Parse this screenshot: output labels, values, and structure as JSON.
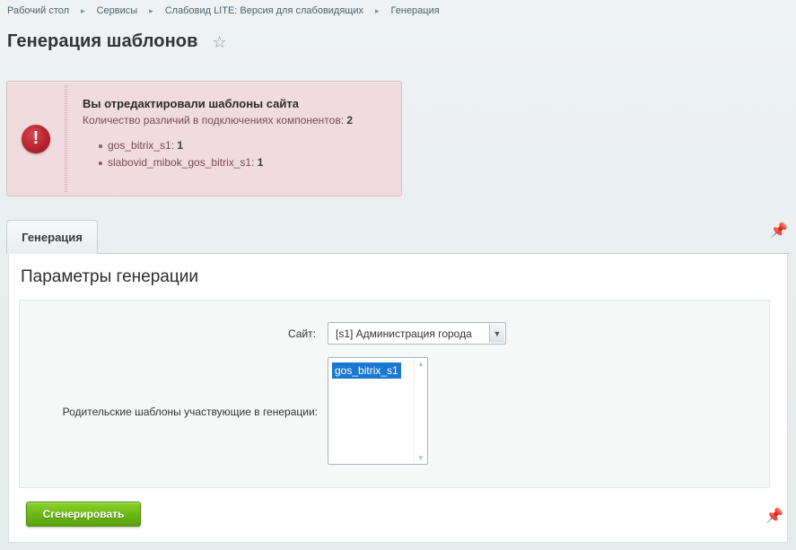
{
  "breadcrumb": {
    "items": [
      "Рабочий стол",
      "Сервисы",
      "Слабовид LITE: Версия для слабовидящих",
      "Генерация"
    ],
    "separator": "▸"
  },
  "page": {
    "title": "Генерация шаблонов",
    "star_icon": "☆"
  },
  "alert": {
    "title": "Вы отредактировали шаблоны сайта",
    "text_prefix": "Количество различий в подключениях компонентов: ",
    "text_count": "2",
    "items": [
      {
        "name": "gos_bitrix_s1: ",
        "count": "1"
      },
      {
        "name": "slabovid_mibok_gos_bitrix_s1: ",
        "count": "1"
      }
    ],
    "icon": "!"
  },
  "tabs": [
    {
      "label": "Генерация"
    }
  ],
  "pin_icon": "📌",
  "section": {
    "title": "Параметры генерации"
  },
  "form": {
    "site_label": "Сайт:",
    "site_value": "[s1] Администрация города",
    "select_arrow": "▼",
    "parents_label": "Родительские шаблоны участвующие в генерации:",
    "parents_options": [
      "gos_bitrix_s1"
    ],
    "scroll_up": "▲",
    "scroll_down": "▼"
  },
  "actions": {
    "generate_label": "Сгенерировать"
  },
  "colors": {
    "accent_green": "#6bb516",
    "alert_bg": "#f0dcdf",
    "error_red": "#b3202c",
    "selection_blue": "#1a78d0"
  }
}
